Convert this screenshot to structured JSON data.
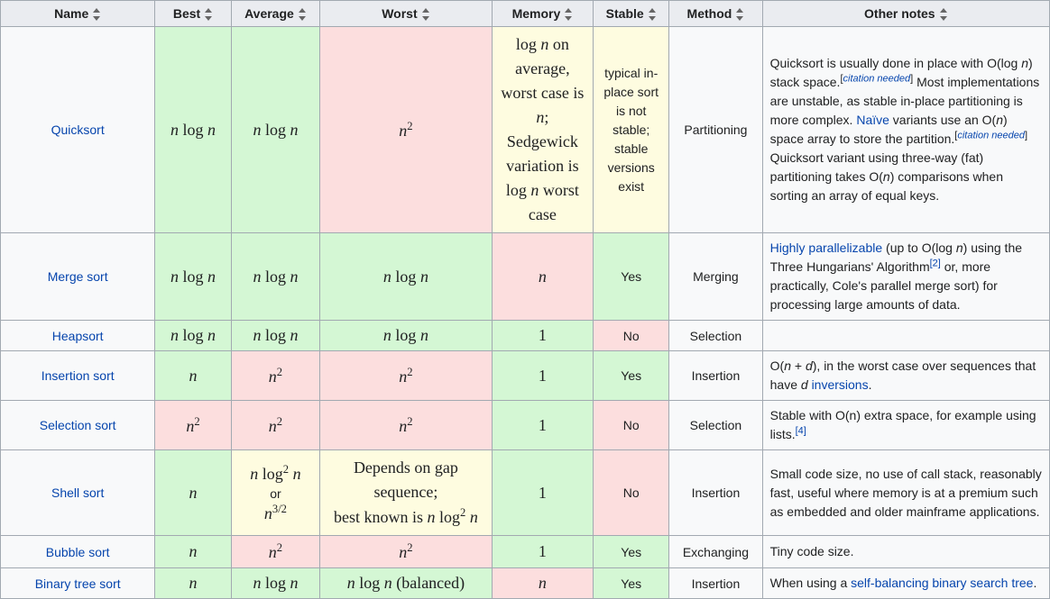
{
  "chart_data": {
    "type": "table",
    "columns": [
      "Name",
      "Best",
      "Average",
      "Worst",
      "Memory",
      "Stable",
      "Method",
      "Other notes"
    ],
    "rows": [
      {
        "name": "Quicksort",
        "best": "n log n",
        "average": "n log n",
        "worst": "n^2",
        "memory": "log n on average, worst case is n; Sedgewick variation is log n worst case",
        "stable": "typical in-place sort is not stable; stable versions exist",
        "method": "Partitioning",
        "notes": "Quicksort is usually done in place with O(log n) stack space.[citation needed] Most implementations are unstable, as stable in-place partitioning is more complex. Naïve variants use an O(n) space array to store the partition.[citation needed] Quicksort variant using three-way (fat) partitioning takes O(n) comparisons when sorting an array of equal keys."
      },
      {
        "name": "Merge sort",
        "best": "n log n",
        "average": "n log n",
        "worst": "n log n",
        "memory": "n",
        "stable": "Yes",
        "method": "Merging",
        "notes": "Highly parallelizable (up to O(log n) using the Three Hungarians' Algorithm[2] or, more practically, Cole's parallel merge sort) for processing large amounts of data."
      },
      {
        "name": "Heapsort",
        "best": "n log n",
        "average": "n log n",
        "worst": "n log n",
        "memory": "1",
        "stable": "No",
        "method": "Selection",
        "notes": ""
      },
      {
        "name": "Insertion sort",
        "best": "n",
        "average": "n^2",
        "worst": "n^2",
        "memory": "1",
        "stable": "Yes",
        "method": "Insertion",
        "notes": "O(n + d), in the worst case over sequences that have d inversions."
      },
      {
        "name": "Selection sort",
        "best": "n^2",
        "average": "n^2",
        "worst": "n^2",
        "memory": "1",
        "stable": "No",
        "method": "Selection",
        "notes": "Stable with O(n) extra space, for example using lists.[4]"
      },
      {
        "name": "Shell sort",
        "best": "n",
        "average": "n log^2 n or n^(3/2)",
        "worst": "Depends on gap sequence; best known is n log^2 n",
        "memory": "1",
        "stable": "No",
        "method": "Insertion",
        "notes": "Small code size, no use of call stack, reasonably fast, useful where memory is at a premium such as embedded and older mainframe applications."
      },
      {
        "name": "Bubble sort",
        "best": "n",
        "average": "n^2",
        "worst": "n^2",
        "memory": "1",
        "stable": "Yes",
        "method": "Exchanging",
        "notes": "Tiny code size."
      },
      {
        "name": "Binary tree sort",
        "best": "n",
        "average": "n log n",
        "worst": "n log n (balanced)",
        "memory": "n",
        "stable": "Yes",
        "method": "Insertion",
        "notes": "When using a self-balancing binary search tree."
      }
    ]
  },
  "headers": {
    "name": "Name",
    "best": "Best",
    "average": "Average",
    "worst": "Worst",
    "memory": "Memory",
    "stable": "Stable",
    "method": "Method",
    "notes": "Other notes"
  },
  "rows": [
    {
      "name": "Quicksort",
      "method": "Partitioning"
    },
    {
      "name": "Merge sort",
      "stable": "Yes",
      "method": "Merging"
    },
    {
      "name": "Heapsort",
      "stable": "No",
      "method": "Selection",
      "notes": ""
    },
    {
      "name": "Insertion sort",
      "stable": "Yes",
      "method": "Insertion"
    },
    {
      "name": "Selection sort",
      "stable": "No",
      "method": "Selection"
    },
    {
      "name": "Shell sort",
      "stable": "No",
      "method": "Insertion"
    },
    {
      "name": "Bubble sort",
      "stable": "Yes",
      "method": "Exchanging",
      "notes": "Tiny code size."
    },
    {
      "name": "Binary tree sort",
      "stable": "Yes",
      "method": "Insertion"
    }
  ],
  "text": {
    "on_average": " on average, worst case is ",
    "sedgewick": "; Sedgewick variation is ",
    "worst_case": " worst case",
    "quicksort_stable": "typical in-place sort is not stable; stable versions exist",
    "quicksort_notes_1": "Quicksort is usually done in place with O(log ",
    "quicksort_notes_2": ") stack space.",
    "citation_needed": "citation needed",
    "quicksort_notes_3": " Most implementations are unstable, as stable in-place partitioning is more complex. ",
    "naive": "Naïve",
    "quicksort_notes_4": " variants use an O(",
    "quicksort_notes_5": ") space array to store the partition.",
    "quicksort_notes_6": " Quicksort variant using three-way (fat) partitioning takes O(",
    "quicksort_notes_7": ") comparisons when sorting an array of equal keys.",
    "merge_notes_1": "Highly parallelizable",
    "merge_notes_2": " (up to O(log ",
    "merge_notes_3": ") using the Three Hungarians' Algorithm",
    "ref2": "[2]",
    "merge_notes_4": " or, more practically, Cole's parallel merge sort) for processing large amounts of data.",
    "insertion_notes_1": "O(",
    "insertion_notes_2": " + ",
    "insertion_notes_3": "), in the worst case over sequences that have ",
    "inversions": "inversions",
    "period": ".",
    "selection_notes_1": "Stable with O(n) extra space, for example using lists.",
    "ref4": "[4]",
    "shell_or": "or",
    "shell_worst_1": "Depends on gap sequence;",
    "shell_worst_2": "best known is ",
    "shell_notes": "Small code size, no use of call stack, reasonably fast, useful where memory is at a premium such as embedded and older mainframe applications.",
    "binary_notes_1": "When using a ",
    "binary_link": "self-balancing binary search tree",
    "balanced": " (balanced)",
    "var_n": "n",
    "var_d": "d",
    "space": " "
  }
}
